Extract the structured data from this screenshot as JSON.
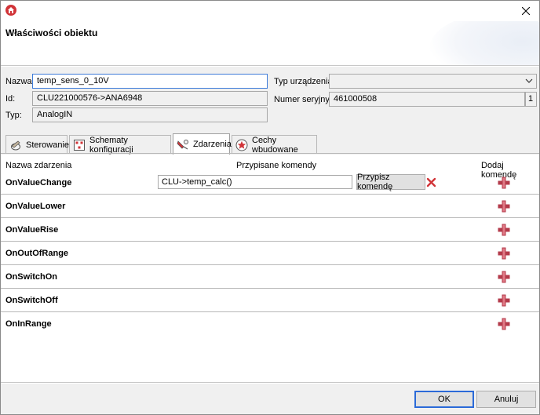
{
  "window": {
    "title_icon": "house-icon",
    "close_icon": "close-icon"
  },
  "header": {
    "title": "Właściwości obiektu"
  },
  "form": {
    "name_label": "Nazwa:",
    "name_value": "temp_sens_0_10V",
    "id_label": "Id:",
    "id_value": "CLU221000576->ANA6948",
    "type_label": "Typ:",
    "type_value": "AnalogIN",
    "device_type_label": "Typ urządzenia:",
    "device_type_value": "",
    "serial_label": "Numer seryjny:",
    "serial_value": "461000508",
    "serial_count": "1"
  },
  "tabs": [
    {
      "label": "Sterowanie",
      "icon": "control-icon"
    },
    {
      "label": "Schematy konfiguracji",
      "icon": "schema-icon"
    },
    {
      "label": "Zdarzenia",
      "icon": "events-icon",
      "selected": true
    },
    {
      "label": "Cechy wbudowane",
      "icon": "star-icon"
    }
  ],
  "events_table": {
    "col_event": "Nazwa zdarzenia",
    "col_commands": "Przypisane komendy",
    "col_add": "Dodaj komendę",
    "rows": [
      {
        "name": "OnValueChange",
        "command": "CLU->temp_calc()",
        "assign_label": "Przypisz komendę"
      },
      {
        "name": "OnValueLower"
      },
      {
        "name": "OnValueRise"
      },
      {
        "name": "OnOutOfRange"
      },
      {
        "name": "OnSwitchOn"
      },
      {
        "name": "OnSwitchOff"
      },
      {
        "name": "OnInRange"
      }
    ]
  },
  "footer": {
    "ok_label": "OK",
    "cancel_label": "Anuluj"
  },
  "colors": {
    "accent": "#2b6ad8",
    "add_icon": "#b33a4a",
    "delete_icon": "#d13438"
  }
}
